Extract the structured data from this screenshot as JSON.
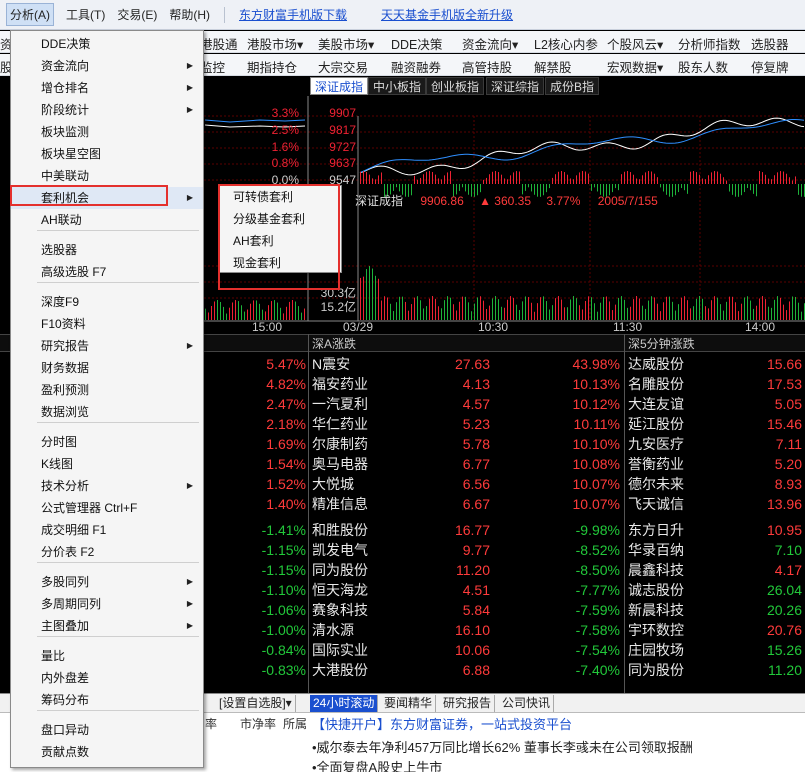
{
  "menubar": {
    "items": [
      "分析(A)",
      "工具(T)",
      "交易(E)",
      "帮助(H)"
    ],
    "links": [
      "东方财富手机版下载",
      "天天基金手机版全新升级"
    ]
  },
  "toolbar": {
    "row1": [
      "港股通",
      "港股市场▾",
      "美股市场▾",
      "DDE决策",
      "资金流向▾",
      "L2核心内参",
      "个股风云▾",
      "分析师指数",
      "选股器"
    ],
    "row2": [
      "监控",
      "期指持仓",
      "大宗交易",
      "融资融券",
      "高管持股",
      "解禁股",
      "宏观数据▾",
      "股东人数",
      "停复牌"
    ],
    "left_stub1": "资",
    "left_stub2": "股"
  },
  "chart_tabs": [
    "深证成指",
    "中小板指",
    "创业板指",
    "深证综指",
    "成份B指"
  ],
  "chart": {
    "name": "深证成指",
    "price": "9906.86",
    "change": "▲ 360.35",
    "pct": "3.77%",
    "date_stats": "2005/7/155",
    "right_axis": [
      "3.3%",
      "2.5%",
      "1.6%",
      "0.8%",
      "0.0%"
    ],
    "left_axis": [
      "9907",
      "9817",
      "9727",
      "9637",
      "9547"
    ],
    "volume_labels": [
      "30.3亿",
      "15.2亿"
    ],
    "time_labels": [
      "15:00",
      "03/29",
      "10:30",
      "11:30",
      "14:00"
    ]
  },
  "tables": {
    "left_header": "",
    "mid_header": "深A涨跌",
    "right_header": "深5分钟涨跌",
    "left_pcts": [
      "5.47%",
      "4.82%",
      "2.47%",
      "2.18%",
      "1.69%",
      "1.54%",
      "1.52%",
      "1.40%",
      "-1.41%",
      "-1.15%",
      "-1.15%",
      "-1.10%",
      "-1.06%",
      "-1.00%",
      "-0.84%",
      "-0.83%"
    ],
    "mid": [
      {
        "name": "N震安",
        "price": "27.63",
        "pct": "43.98%"
      },
      {
        "name": "福安药业",
        "price": "4.13",
        "pct": "10.13%"
      },
      {
        "name": "一汽夏利",
        "price": "4.57",
        "pct": "10.12%"
      },
      {
        "name": "华仁药业",
        "price": "5.23",
        "pct": "10.11%"
      },
      {
        "name": "尔康制药",
        "price": "5.78",
        "pct": "10.10%"
      },
      {
        "name": "奥马电器",
        "price": "6.77",
        "pct": "10.08%"
      },
      {
        "name": "大悦城",
        "price": "6.56",
        "pct": "10.07%"
      },
      {
        "name": "精准信息",
        "price": "6.67",
        "pct": "10.07%"
      },
      {
        "name": "和胜股份",
        "price": "16.77",
        "pct": "-9.98%"
      },
      {
        "name": "凯发电气",
        "price": "9.77",
        "pct": "-8.52%"
      },
      {
        "name": "同为股份",
        "price": "11.20",
        "pct": "-8.50%"
      },
      {
        "name": "恒天海龙",
        "price": "4.51",
        "pct": "-7.77%"
      },
      {
        "name": "赛象科技",
        "price": "5.84",
        "pct": "-7.59%"
      },
      {
        "name": "清水源",
        "price": "16.10",
        "pct": "-7.58%"
      },
      {
        "name": "国际实业",
        "price": "10.06",
        "pct": "-7.54%"
      },
      {
        "name": "大港股份",
        "price": "6.88",
        "pct": "-7.40%"
      }
    ],
    "right": [
      {
        "name": "达威股份",
        "price": "15.66"
      },
      {
        "name": "名雕股份",
        "price": "17.53"
      },
      {
        "name": "大连友谊",
        "price": "5.05"
      },
      {
        "name": "延江股份",
        "price": "15.46"
      },
      {
        "name": "九安医疗",
        "price": "7.11"
      },
      {
        "name": "誉衡药业",
        "price": "5.20"
      },
      {
        "name": "德尔未来",
        "price": "8.93"
      },
      {
        "name": "飞天诚信",
        "price": "13.96"
      },
      {
        "name": "东方日升",
        "price": "10.95"
      },
      {
        "name": "华录百纳",
        "price": "7.10"
      },
      {
        "name": "晨鑫科技",
        "price": "4.17"
      },
      {
        "name": "诚志股份",
        "price": "26.04"
      },
      {
        "name": "新晨科技",
        "price": "20.26"
      },
      {
        "name": "宇环数控",
        "price": "20.76"
      },
      {
        "name": "庄园牧场",
        "price": "15.26"
      },
      {
        "name": "同为股份",
        "price": "11.20"
      }
    ]
  },
  "news": {
    "tabs": [
      "[设置自选股]▾",
      "24小时滚动",
      "要闻精华",
      "研究报告",
      "公司快讯"
    ],
    "cols": [
      "率",
      "市净率",
      "所属"
    ],
    "headline": "【快捷开户】东方财富证券，一站式投资平台",
    "item1": "•威尔泰去年净利457万同比增长62% 董事长李彧未在公司领取报酬",
    "item2": "•全面复盘A股史上牛市"
  },
  "menu": {
    "items": [
      {
        "label": "DDE决策",
        "arrow": false
      },
      {
        "label": "资金流向",
        "arrow": true
      },
      {
        "label": "增仓排名",
        "arrow": true
      },
      {
        "label": "阶段统计",
        "arrow": true
      },
      {
        "label": "板块监测",
        "arrow": false
      },
      {
        "label": "板块星空图",
        "arrow": false
      },
      {
        "label": "中美联动",
        "arrow": false
      },
      {
        "label": "套利机会",
        "arrow": true
      },
      {
        "label": "AH联动",
        "arrow": false
      },
      {
        "label": "选股器",
        "arrow": false
      },
      {
        "label": "高级选股 F7",
        "arrow": false
      },
      {
        "label": "深度F9",
        "arrow": false
      },
      {
        "label": "F10资料",
        "arrow": false
      },
      {
        "label": "研究报告",
        "arrow": true
      },
      {
        "label": "财务数据",
        "arrow": false
      },
      {
        "label": "盈利预测",
        "arrow": false
      },
      {
        "label": "数据浏览",
        "arrow": false
      },
      {
        "label": "分时图",
        "arrow": false
      },
      {
        "label": "K线图",
        "arrow": false
      },
      {
        "label": "技术分析",
        "arrow": true
      },
      {
        "label": "公式管理器    Ctrl+F",
        "arrow": false
      },
      {
        "label": "成交明细      F1",
        "arrow": false
      },
      {
        "label": "分价表        F2",
        "arrow": false
      },
      {
        "label": "多股同列",
        "arrow": true
      },
      {
        "label": "多周期同列",
        "arrow": true
      },
      {
        "label": "主图叠加",
        "arrow": true
      },
      {
        "label": "量比",
        "arrow": false
      },
      {
        "label": "内外盘差",
        "arrow": false
      },
      {
        "label": "筹码分布",
        "arrow": false
      },
      {
        "label": "盘口异动",
        "arrow": false
      },
      {
        "label": "贡献点数",
        "arrow": false
      }
    ],
    "submenu": [
      "可转债套利",
      "分级基金套利",
      "AH套利",
      "现金套利"
    ]
  },
  "colors": {
    "up": "#ff3b3b",
    "down": "#22c83a",
    "highlight": "#e4302d",
    "link": "#1a4fcf"
  }
}
